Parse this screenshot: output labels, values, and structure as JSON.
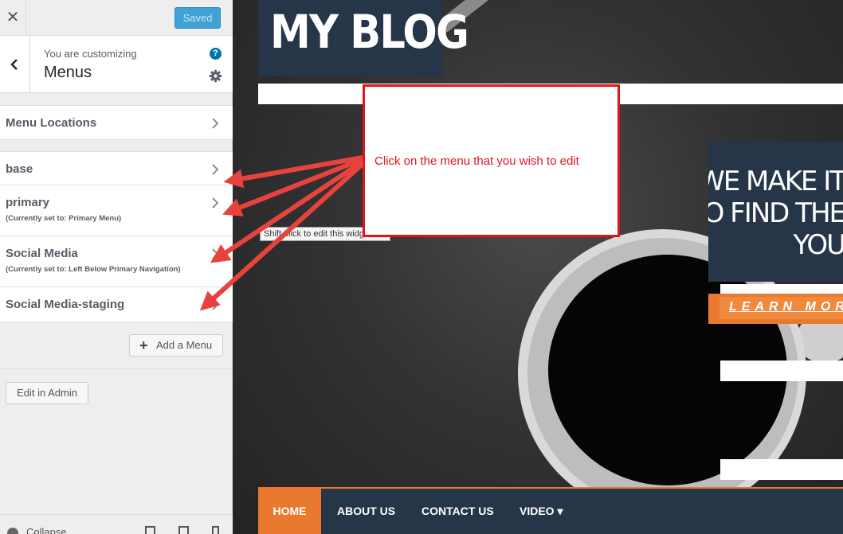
{
  "topbar": {
    "close_icon": "close-icon",
    "saved_label": "Saved"
  },
  "section": {
    "customizing_label": "You are customizing",
    "title": "Menus",
    "help_icon": "?"
  },
  "rows": [
    {
      "title": "Menu Locations",
      "subtitle": ""
    },
    {
      "title": "base",
      "subtitle": ""
    },
    {
      "title": "primary",
      "subtitle": "(Currently set to: Primary Menu)"
    },
    {
      "title": "Social Media",
      "subtitle": "(Currently set to: Left Below Primary Navigation)"
    },
    {
      "title": "Social Media-staging",
      "subtitle": ""
    }
  ],
  "actions": {
    "add_menu_label": "Add a Menu",
    "add_icon": "+",
    "edit_admin_label": "Edit in Admin"
  },
  "footer": {
    "collapse_label": "Collapse"
  },
  "preview": {
    "blog_title": "MY BLOG",
    "tooltip": "Shift-click to edit this widget.",
    "hero_line1": "WE MAKE IT",
    "hero_line2": "TO FIND THE",
    "hero_line3": "YOU",
    "learn_more": "LEARN MORE",
    "nav": [
      "HOME",
      "ABOUT US",
      "CONTACT US",
      "VIDEO"
    ],
    "nav_dropdown_icon": "▾"
  },
  "annotation": {
    "callout_text": "Click on the menu that you wish to edit"
  },
  "colors": {
    "accent": "#e9792e",
    "navy": "#263548",
    "saved_blue": "#3fa2d3",
    "annotation_red": "#e0141e"
  }
}
